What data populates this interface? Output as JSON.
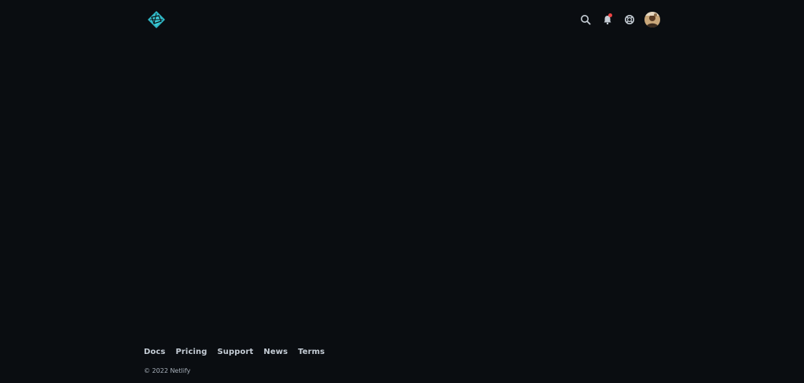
{
  "header": {
    "logo_icon": "netlify-logo-icon",
    "search_icon": "search-icon",
    "notifications_icon": "bell-icon",
    "help_icon": "lifebuoy-icon",
    "notification_badge_color": "#ef4444",
    "accent_color": "#31b7c7"
  },
  "footer": {
    "links": [
      {
        "label": "Docs"
      },
      {
        "label": "Pricing"
      },
      {
        "label": "Support"
      },
      {
        "label": "News"
      },
      {
        "label": "Terms"
      }
    ],
    "copyright": "© 2022 Netlify"
  }
}
